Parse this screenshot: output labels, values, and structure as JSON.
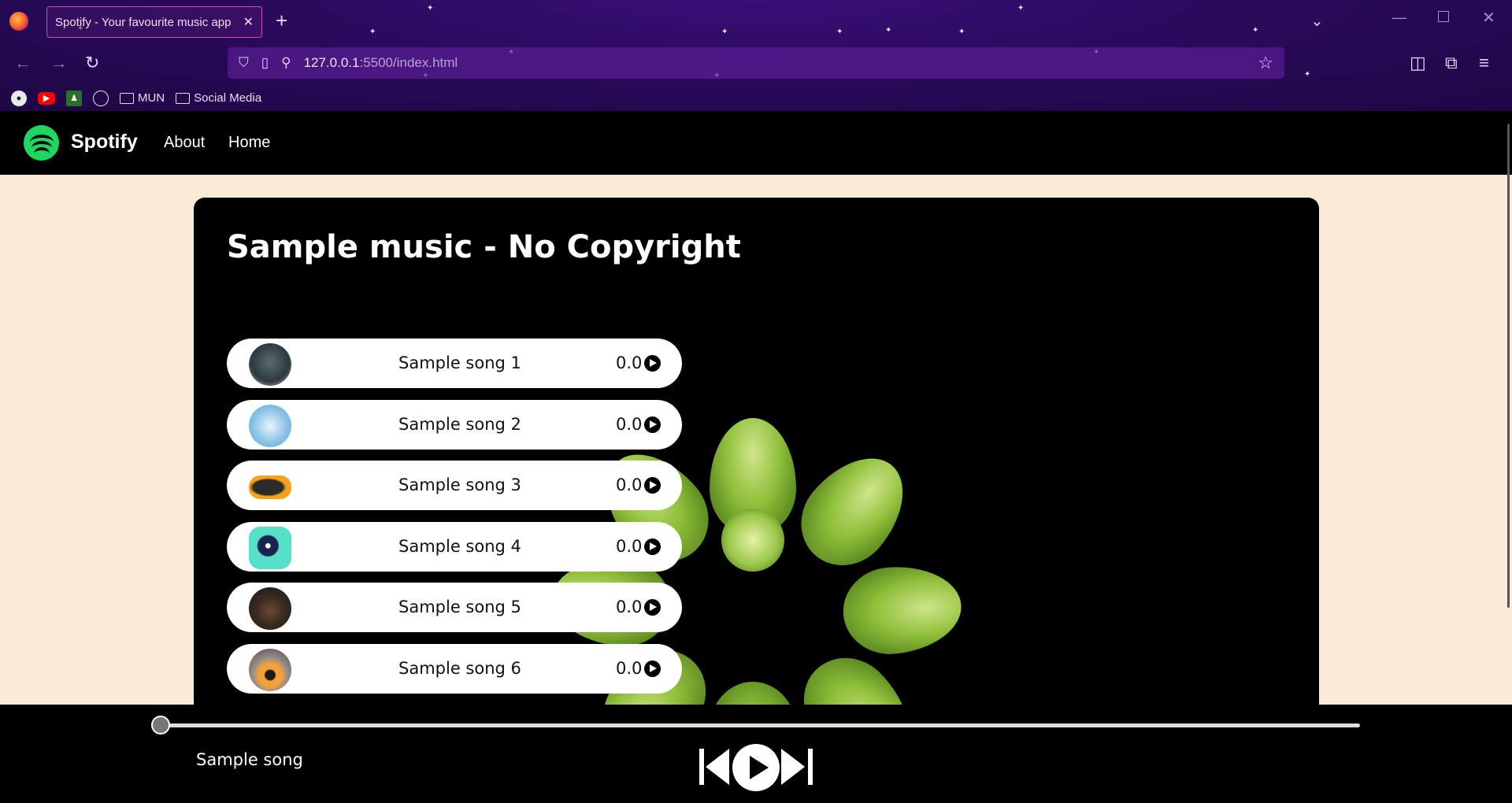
{
  "browser": {
    "tab_title": "Spotify - Your favourite music app",
    "url_host": "127.0.0.1",
    "url_path": ":5500/index.html",
    "bookmarks": [
      {
        "label": "MUN",
        "icon": "folder-icon"
      },
      {
        "label": "Social Media",
        "icon": "folder-icon"
      }
    ]
  },
  "site": {
    "brand": "Spotify",
    "nav": [
      "About",
      "Home"
    ],
    "brand_color": "#1ed760"
  },
  "main": {
    "title": "Sample music - No Copyright",
    "songs": [
      {
        "name": "Sample song 1",
        "time": "0.0"
      },
      {
        "name": "Sample song 2",
        "time": "0.0"
      },
      {
        "name": "Sample song 3",
        "time": "0.0"
      },
      {
        "name": "Sample song 4",
        "time": "0.0"
      },
      {
        "name": "Sample song 5",
        "time": "0.0"
      },
      {
        "name": "Sample song 6",
        "time": "0.0"
      }
    ]
  },
  "player": {
    "now_playing": "Sample song",
    "progress_fraction": 0
  }
}
